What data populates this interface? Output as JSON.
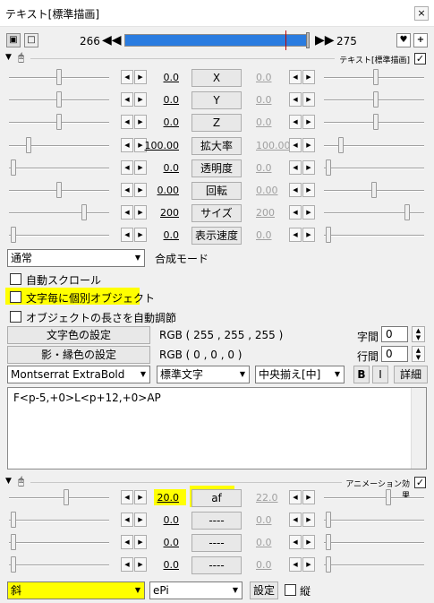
{
  "window": {
    "title": "テキスト[標準描画]",
    "close": "×"
  },
  "timeline": {
    "start": "266",
    "end": "275",
    "prev": "◀◀",
    "next": "▶▶",
    "position": 0.88
  },
  "text_section": {
    "label": "テキスト[標準描画]",
    "checked": true
  },
  "params": [
    {
      "left": "0.0",
      "name": "X",
      "right": "0.0",
      "left_slider": 0.5,
      "right_slider": 0.52
    },
    {
      "left": "0.0",
      "name": "Y",
      "right": "0.0",
      "left_slider": 0.5,
      "right_slider": 0.52
    },
    {
      "left": "0.0",
      "name": "Z",
      "right": "0.0",
      "left_slider": 0.5,
      "right_slider": 0.52
    },
    {
      "left": "100.00",
      "name": "拡大率",
      "right": "100.00",
      "left_slider": 0.18,
      "right_slider": 0.15
    },
    {
      "left": "0.0",
      "name": "透明度",
      "right": "0.0",
      "left_slider": 0.02,
      "right_slider": 0.02
    },
    {
      "left": "0.00",
      "name": "回転",
      "right": "0.00",
      "left_slider": 0.5,
      "right_slider": 0.5
    },
    {
      "left": "200",
      "name": "サイズ",
      "right": "200",
      "left_slider": 0.76,
      "right_slider": 0.85
    },
    {
      "left": "0.0",
      "name": "表示速度",
      "right": "0.0",
      "left_slider": 0.02,
      "right_slider": 0.02
    }
  ],
  "blend": {
    "value": "通常",
    "label": "合成モード"
  },
  "checks": [
    {
      "label": "自動スクロール",
      "checked": false,
      "highlight": false
    },
    {
      "label": "文字毎に個別オブジェクト",
      "checked": false,
      "highlight": true
    },
    {
      "label": "オブジェクトの長さを自動調節",
      "checked": false,
      "highlight": false
    }
  ],
  "color": {
    "text_btn": "文字色の設定",
    "text_rgb": "RGB ( 255 , 255 , 255 )",
    "shadow_btn": "影・縁色の設定",
    "shadow_rgb": "RGB ( 0 , 0 , 0 )",
    "char_spacing_label": "字間",
    "char_spacing": "0",
    "line_spacing_label": "行間",
    "line_spacing": "0"
  },
  "font": {
    "family": "Montserrat ExtraBold",
    "style": "標準文字",
    "align": "中央揃え[中]",
    "bold": "B",
    "italic": "I",
    "detail": "詳細"
  },
  "text_content": "F<p-5,+0>L<p+12,+0>AP",
  "anim_section": {
    "label": "アニメーション効果",
    "checked": true
  },
  "anim_params": [
    {
      "left": "20.0",
      "name": "af",
      "right": "22.0",
      "left_slider": 0.58,
      "right_slider": 0.65,
      "highlight": true
    },
    {
      "left": "0.0",
      "name": "----",
      "right": "0.0",
      "left_slider": 0.02,
      "right_slider": 0.02,
      "highlight": false
    },
    {
      "left": "0.0",
      "name": "----",
      "right": "0.0",
      "left_slider": 0.02,
      "right_slider": 0.02,
      "highlight": false
    },
    {
      "left": "0.0",
      "name": "----",
      "right": "0.0",
      "left_slider": 0.02,
      "right_slider": 0.02,
      "highlight": false
    }
  ],
  "anim_bottom": {
    "type": "斜",
    "script": "ePi",
    "settings": "設定",
    "vertical_label": "縦",
    "vertical_checked": false
  },
  "icons": {
    "spin_left": "◀",
    "spin_right": "▶",
    "dropdown": "▼",
    "check": "✓",
    "up": "▲",
    "down": "▼",
    "dropper": "♥",
    "plus": "+"
  }
}
